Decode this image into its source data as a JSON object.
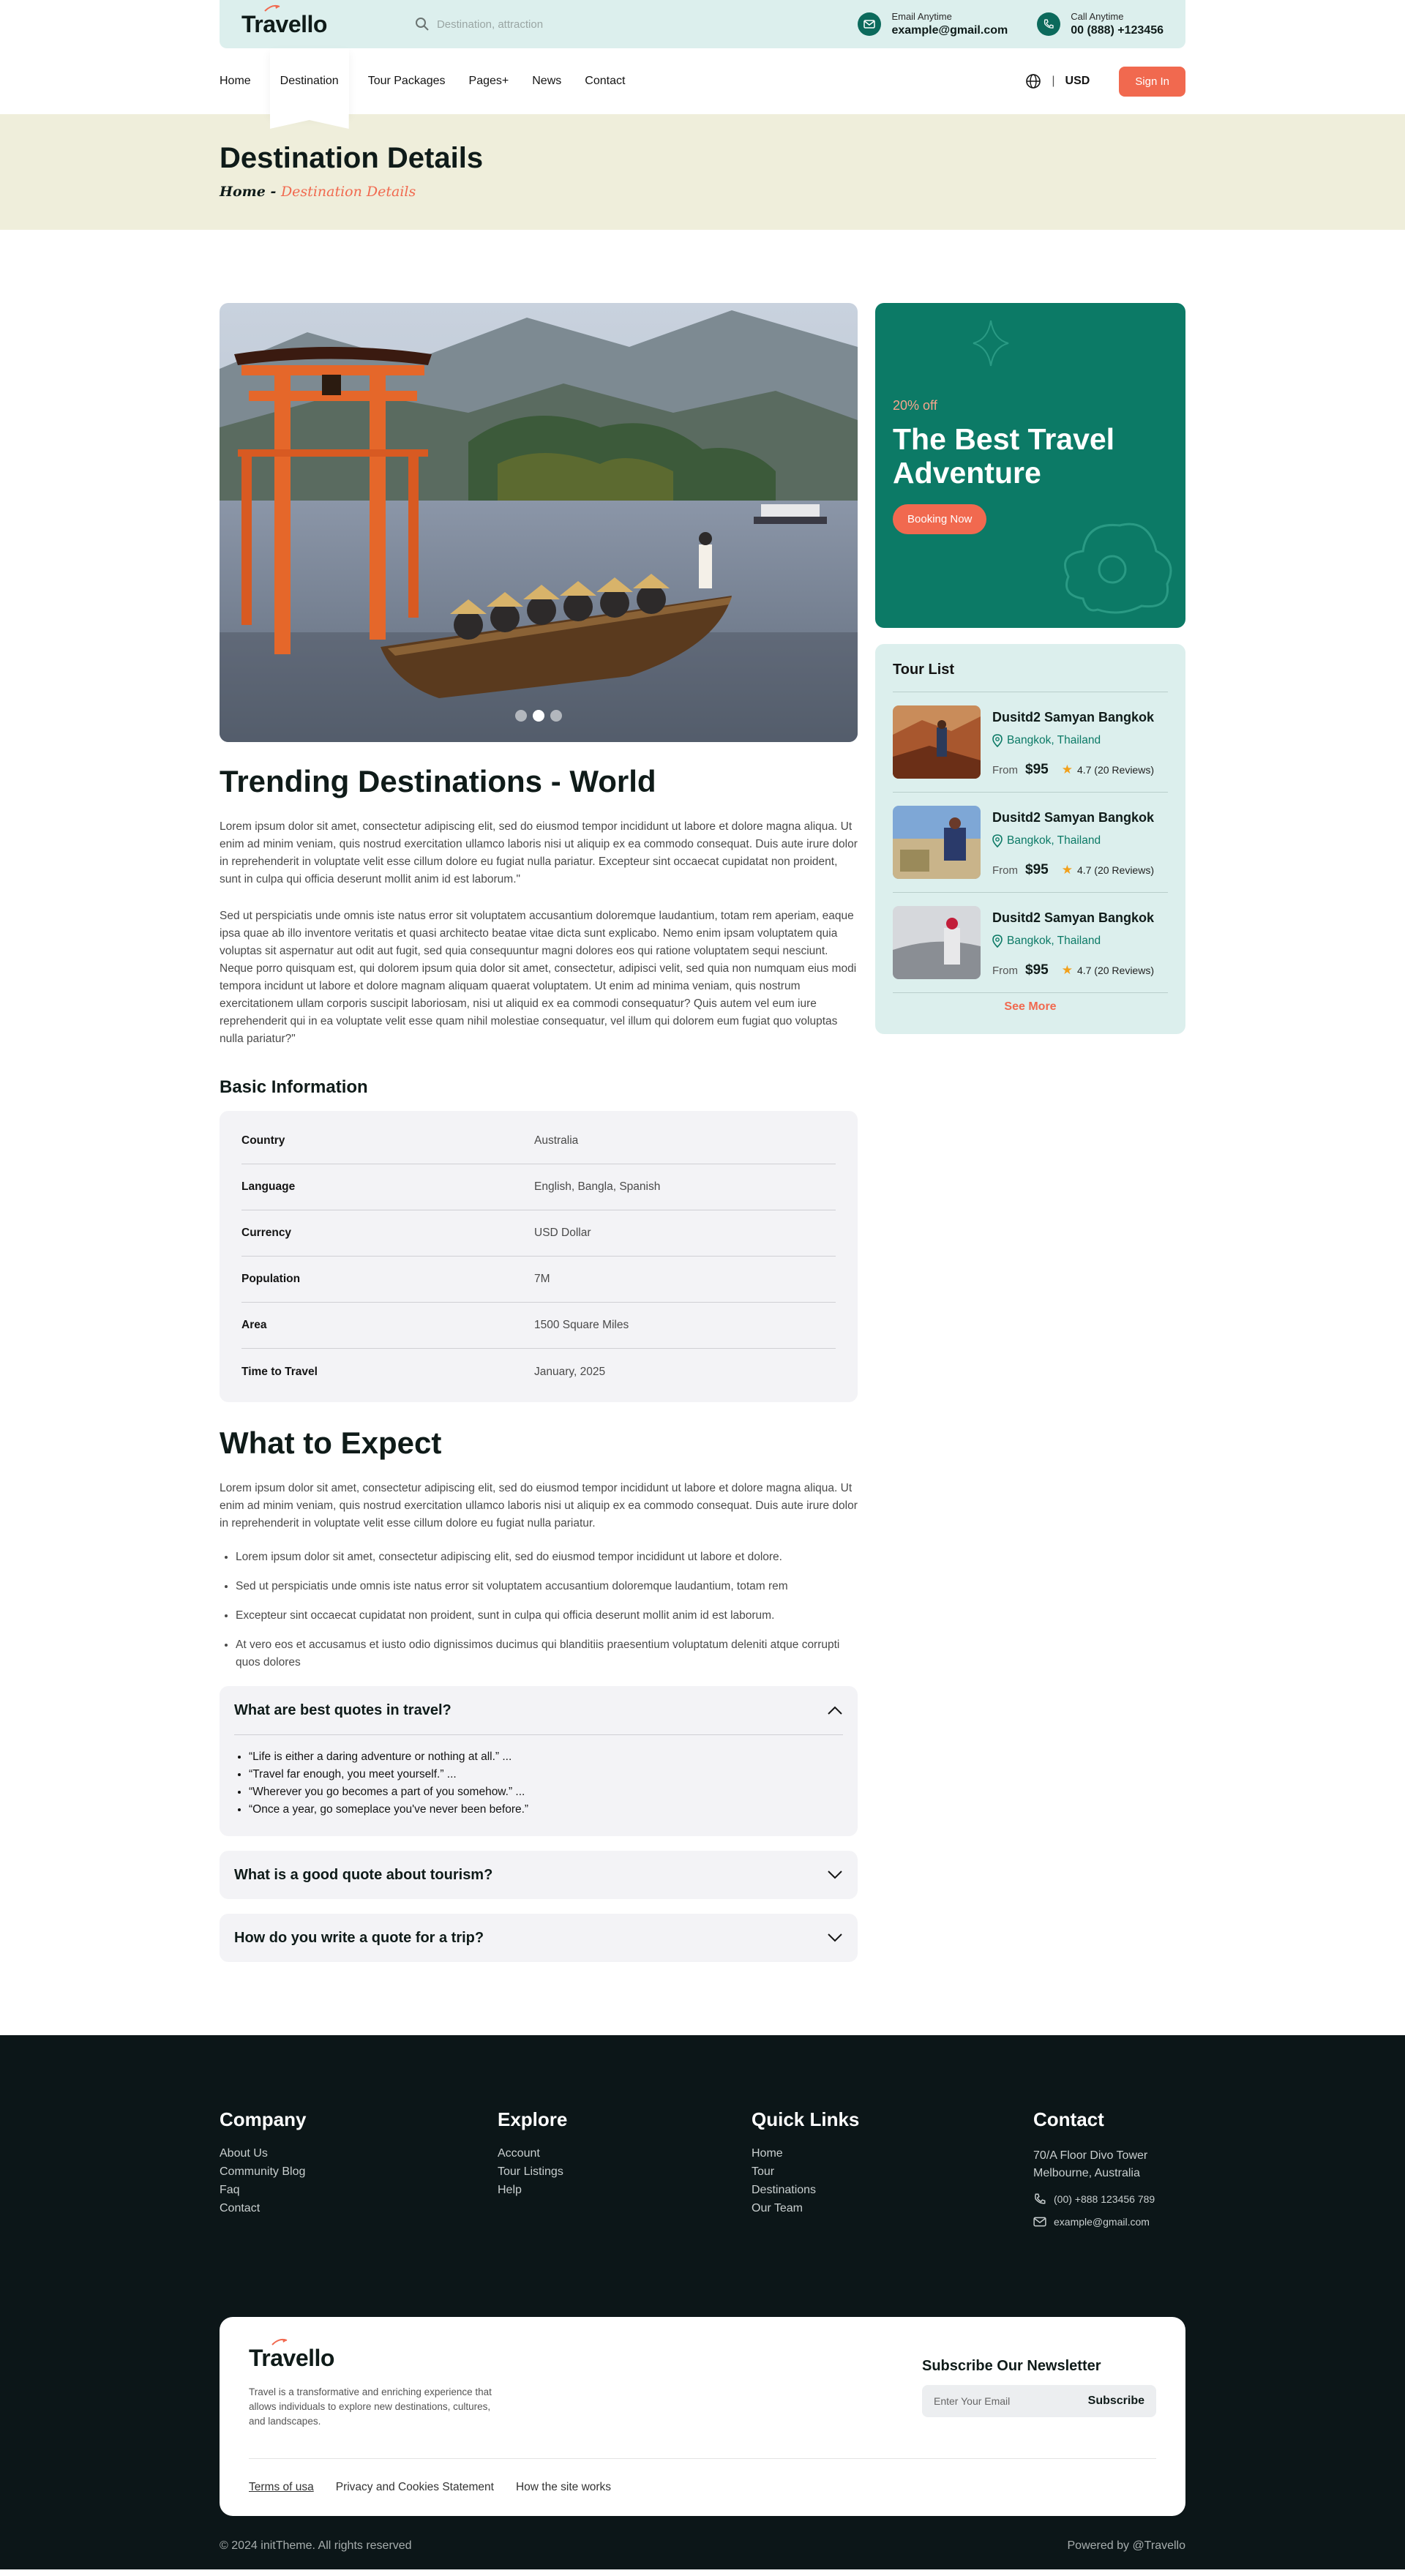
{
  "header": {
    "logo": "Travello",
    "search_placeholder": "Destination, attraction",
    "email_label": "Email Anytime",
    "email_value": "example@gmail.com",
    "call_label": "Call Anytime",
    "call_value": "00 (888) +123456"
  },
  "nav": {
    "items": [
      "Home",
      "Destination",
      "Tour Packages",
      "Pages+",
      "News",
      "Contact"
    ],
    "currency": "USD",
    "signin": "Sign In"
  },
  "banner": {
    "title": "Destination Details",
    "crumb_home": "Home",
    "crumb_sep": " - ",
    "crumb_current": "Destination Details"
  },
  "article": {
    "title": "Trending Destinations - World",
    "para1": "Lorem ipsum dolor sit amet, consectetur adipiscing elit, sed do eiusmod tempor incididunt ut labore et dolore magna aliqua. Ut enim ad minim veniam, quis nostrud exercitation ullamco laboris nisi ut aliquip ex ea commodo consequat. Duis aute irure dolor in reprehenderit in voluptate velit esse cillum dolore eu fugiat nulla pariatur. Excepteur sint occaecat cupidatat non proident, sunt in culpa qui officia deserunt mollit anim id est laborum.\"",
    "para2": "Sed ut perspiciatis unde omnis iste natus error sit voluptatem accusantium doloremque laudantium, totam rem aperiam, eaque ipsa quae ab illo inventore veritatis et quasi architecto beatae vitae dicta sunt explicabo. Nemo enim ipsam voluptatem quia voluptas sit aspernatur aut odit aut fugit, sed quia consequuntur magni dolores eos qui ratione voluptatem sequi nesciunt. Neque porro quisquam est, qui dolorem ipsum quia dolor sit amet, consectetur, adipisci velit, sed quia non numquam eius modi tempora incidunt ut labore et dolore magnam aliquam quaerat voluptatem. Ut enim ad minima veniam, quis nostrum exercitationem ullam corporis suscipit laboriosam, nisi ut aliquid ex ea commodi consequatur? Quis autem vel eum iure reprehenderit qui in ea voluptate velit esse quam nihil molestiae consequatur, vel illum qui dolorem eum fugiat quo voluptas nulla pariatur?\"",
    "basic_title": "Basic Information",
    "basic_rows": [
      {
        "k": "Country",
        "v": "Australia"
      },
      {
        "k": "Language",
        "v": "English, Bangla, Spanish"
      },
      {
        "k": "Currency",
        "v": "USD Dollar"
      },
      {
        "k": "Population",
        "v": "7M"
      },
      {
        "k": "Area",
        "v": "1500 Square Miles"
      },
      {
        "k": "Time to Travel",
        "v": "January, 2025"
      }
    ],
    "expect_title": "What to Expect",
    "expect_para": "Lorem ipsum dolor sit amet, consectetur adipiscing elit, sed do eiusmod tempor incididunt ut labore et dolore magna aliqua. Ut enim ad minim veniam, quis nostrud exercitation ullamco laboris nisi ut aliquip ex ea commodo consequat. Duis aute irure dolor in reprehenderit in voluptate velit esse cillum dolore eu fugiat nulla pariatur.",
    "bullets": [
      "Lorem ipsum dolor sit amet, consectetur adipiscing elit, sed do eiusmod tempor incididunt ut labore et dolore.",
      "Sed ut perspiciatis unde omnis iste natus error sit voluptatem accusantium doloremque laudantium, totam rem",
      "Excepteur sint occaecat cupidatat non proident, sunt in culpa qui officia deserunt mollit anim id est laborum.",
      "At vero eos et accusamus et iusto odio dignissimos ducimus qui blanditiis praesentium voluptatum deleniti atque corrupti quos dolores"
    ],
    "faq": [
      {
        "q": "What are best quotes in travel?",
        "answers": [
          "“Life is either a daring adventure or nothing at all.” ...",
          "“Travel far enough, you meet yourself.” ...",
          "“Wherever you go becomes a part of you somehow.” ...",
          "“Once a year, go someplace you've never been before.”"
        ]
      },
      {
        "q": "What is a good quote about tourism?"
      },
      {
        "q": "How do you write a quote for a trip?"
      }
    ]
  },
  "promo": {
    "off": "20% off",
    "headline": "The Best Travel Adventure",
    "button": "Booking Now"
  },
  "tours": {
    "title": "Tour List",
    "items": [
      {
        "name": "Dusitd2 Samyan Bangkok",
        "loc": "Bangkok, Thailand",
        "from": "From",
        "price": "$95",
        "rating": "4.7 (20 Reviews)"
      },
      {
        "name": "Dusitd2 Samyan Bangkok",
        "loc": "Bangkok, Thailand",
        "from": "From",
        "price": "$95",
        "rating": "4.7 (20 Reviews)"
      },
      {
        "name": "Dusitd2 Samyan Bangkok",
        "loc": "Bangkok, Thailand",
        "from": "From",
        "price": "$95",
        "rating": "4.7 (20 Reviews)"
      }
    ],
    "see_more": "See More"
  },
  "footer": {
    "company": {
      "title": "Company",
      "links": [
        "About Us",
        "Community Blog",
        "Faq",
        "Contact"
      ]
    },
    "explore": {
      "title": "Explore",
      "links": [
        "Account",
        "Tour Listings",
        "Help"
      ]
    },
    "quick": {
      "title": "Quick Links",
      "links": [
        "Home",
        "Tour",
        "Destinations",
        "Our Team"
      ]
    },
    "contact": {
      "title": "Contact",
      "address1": "70/A Floor Divo Tower",
      "address2": "Melbourne, Australia",
      "phone": "(00) +888 123456 789",
      "email": "example@gmail.com"
    },
    "card": {
      "logo": "Travello",
      "desc": "Travel is a transformative and enriching experience that allows individuals to explore new destinations, cultures, and landscapes.",
      "news_title": "Subscribe Our Newsletter",
      "news_placeholder": "Enter Your Email",
      "news_button": "Subscribe",
      "terms": "Terms of usa",
      "privacy": "Privacy and Cookies Statement",
      "how": "How the site works"
    },
    "copyright": "© 2024 initTheme. All rights reserved",
    "powered": "Powered by @Travello"
  },
  "colors": {
    "primary": "#0c7a66",
    "accent": "#f1694f",
    "mint": "#dcefed",
    "banner": "#efeedb",
    "footer": "#0c1618"
  }
}
